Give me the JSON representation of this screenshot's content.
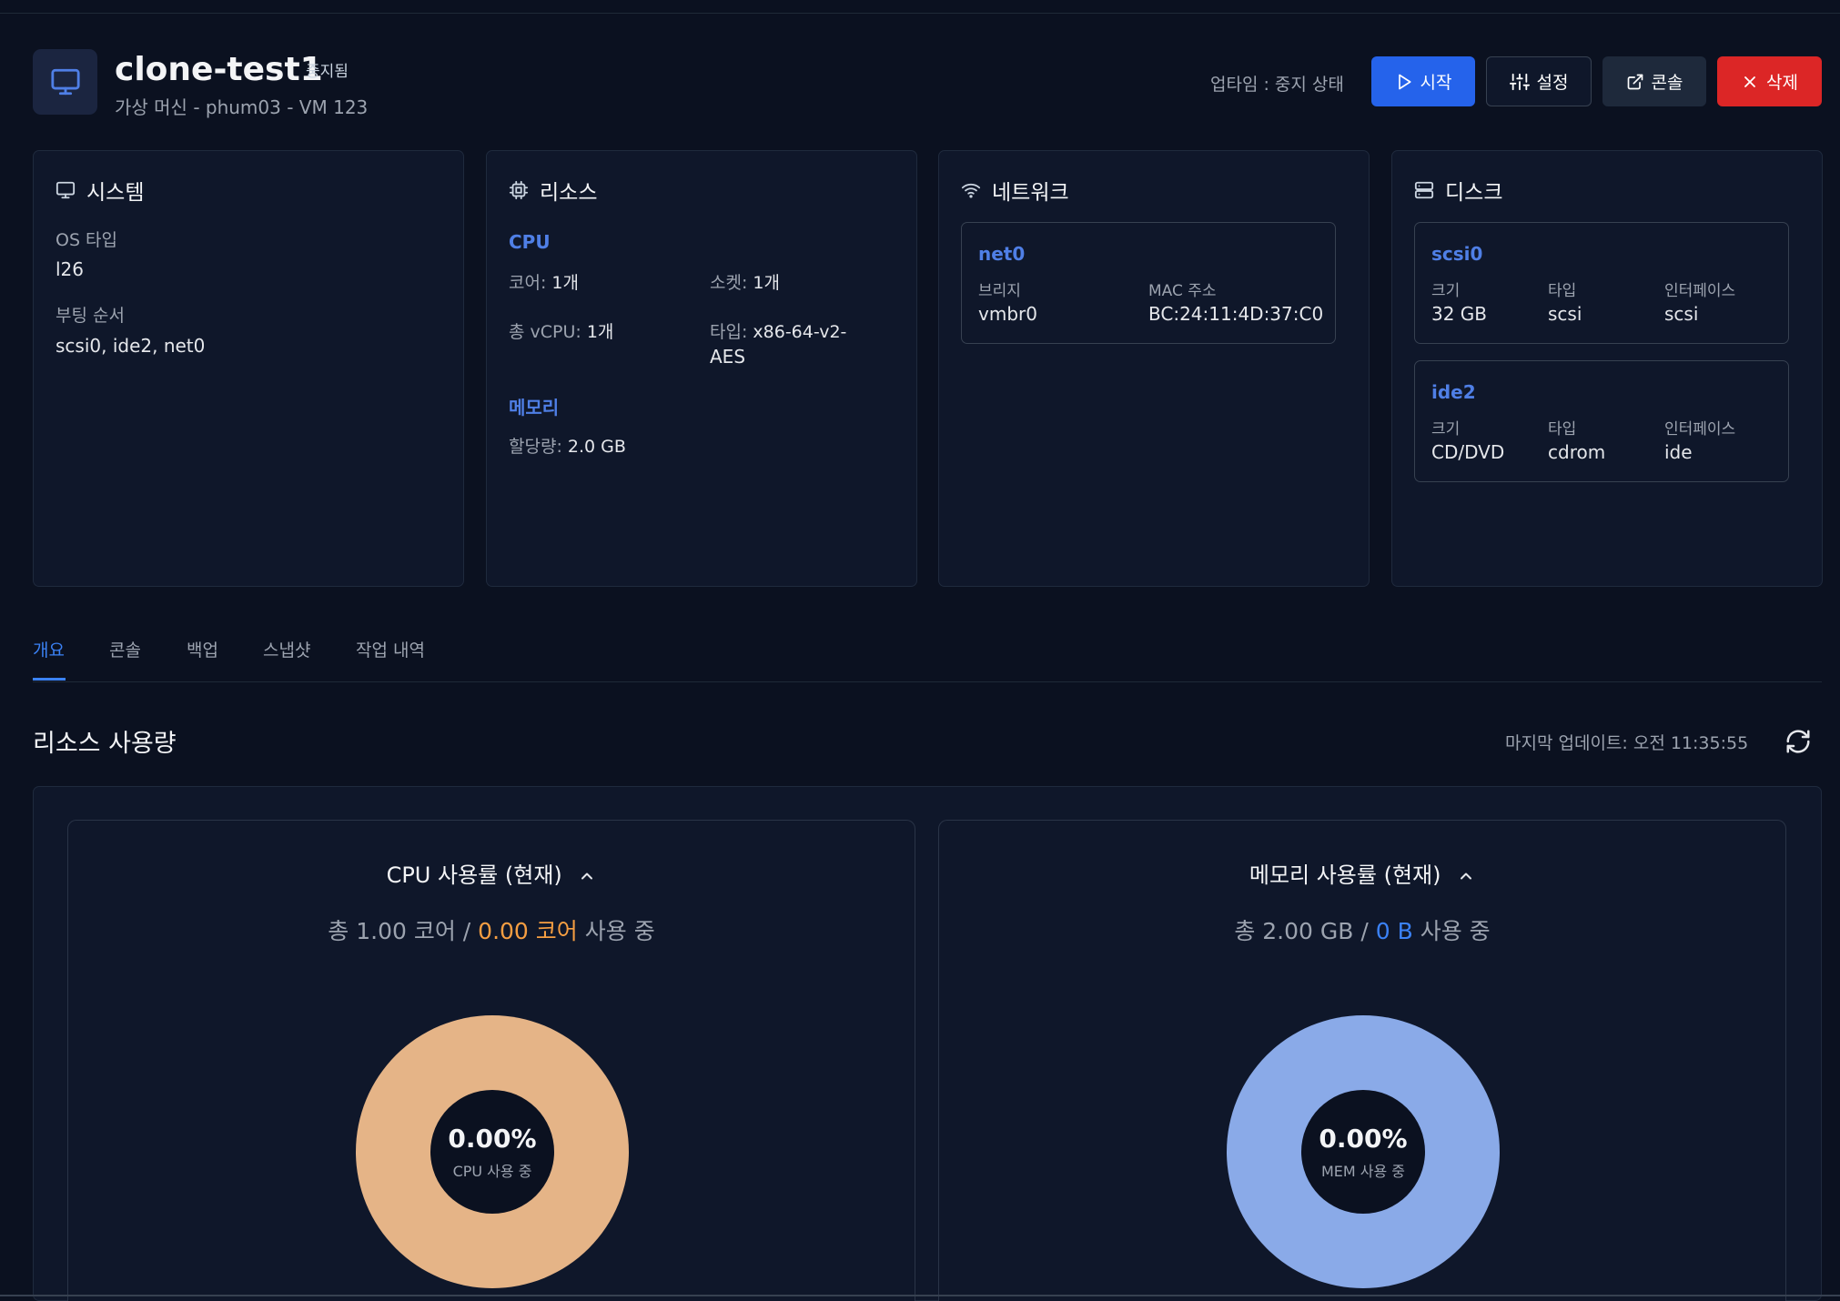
{
  "header": {
    "title": "clone-test1",
    "status": "중지됨",
    "subtitle": "가상 머신 - phum03 - VM 123",
    "uptime": "업타임 : 중지 상태",
    "buttons": {
      "start": "시작",
      "settings": "설정",
      "console": "콘솔",
      "delete": "삭제"
    }
  },
  "system": {
    "title": "시스템",
    "os_label": "OS 타입",
    "os_value": "l26",
    "boot_label": "부팅 순서",
    "boot_value": "scsi0, ide2, net0"
  },
  "resources": {
    "title": "리소스",
    "cpu_section": "CPU",
    "cores_label": "코어: ",
    "cores_value": "1개",
    "sockets_label": "소켓: ",
    "sockets_value": "1개",
    "vcpu_label": "총 vCPU: ",
    "vcpu_value": "1개",
    "type_label": "타입: ",
    "type_value_1": "x86-64-v2-",
    "type_value_2": "AES",
    "memory_section": "메모리",
    "alloc_label": "할당량: ",
    "alloc_value": "2.0 GB"
  },
  "network": {
    "title": "네트워크",
    "interfaces": [
      {
        "name": "net0",
        "bridge_label": "브리지",
        "bridge": "vmbr0",
        "mac_label": "MAC 주소",
        "mac": "BC:24:11:4D:37:C0"
      }
    ]
  },
  "disks": {
    "title": "디스크",
    "items": [
      {
        "name": "scsi0",
        "size_label": "크기",
        "size": "32 GB",
        "type_label": "타입",
        "type": "scsi",
        "iface_label": "인터페이스",
        "iface": "scsi"
      },
      {
        "name": "ide2",
        "size_label": "크기",
        "size": "CD/DVD",
        "type_label": "타입",
        "type": "cdrom",
        "iface_label": "인터페이스",
        "iface": "ide"
      }
    ]
  },
  "tabs": [
    {
      "label": "개요",
      "active": true
    },
    {
      "label": "콘솔"
    },
    {
      "label": "백업"
    },
    {
      "label": "스냅샷"
    },
    {
      "label": "작업 내역"
    }
  ],
  "usage": {
    "title": "리소스 사용량",
    "last_update": "마지막 업데이트: 오전 11:35:55",
    "cpu": {
      "title": "CPU 사용률 (현재)",
      "total": "총 1.00 코어 / ",
      "used": "0.00 코어",
      "suffix": " 사용 중",
      "percent_text": "0.00%",
      "center_label": "CPU 사용 중",
      "percent_value": 0,
      "color": "#e5b487",
      "used_color": "#f59e42"
    },
    "memory": {
      "title": "메모리 사용률 (현재)",
      "total": "총 2.00 GB / ",
      "used": "0 B",
      "suffix": " 사용 중",
      "percent_text": "0.00%",
      "center_label": "MEM 사용 중",
      "percent_value": 0,
      "color": "#8aaae8",
      "used_color": "#3b82f6"
    }
  },
  "colors": {
    "accent": "#2563eb",
    "danger": "#dc2626",
    "link": "#4f7fe6",
    "background": "#0b1120"
  }
}
